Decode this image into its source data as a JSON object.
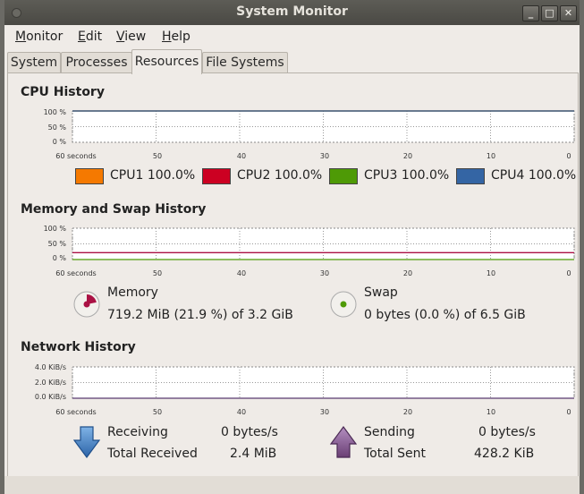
{
  "window": {
    "title": "System Monitor",
    "buttons": [
      "_",
      "□",
      "✕"
    ]
  },
  "menubar": {
    "items": [
      {
        "label": "Monitor",
        "mn": "M",
        "rest": "onitor"
      },
      {
        "label": "Edit",
        "mn": "E",
        "rest": "dit"
      },
      {
        "label": "View",
        "mn": "V",
        "rest": "iew"
      },
      {
        "label": "Help",
        "mn": "H",
        "rest": "elp"
      }
    ]
  },
  "tabs": {
    "items": [
      "System",
      "Processes",
      "Resources",
      "File Systems"
    ],
    "active": "Resources"
  },
  "cpu": {
    "title": "CPU History",
    "ytick_labels": [
      "100 %",
      "50 %",
      "0 %"
    ],
    "xtick_labels": [
      "60 seconds",
      "50",
      "40",
      "30",
      "20",
      "10",
      "0"
    ],
    "legend": [
      {
        "name": "CPU1",
        "value": "100.0%",
        "color": "#f57900"
      },
      {
        "name": "CPU2",
        "value": "100.0%",
        "color": "#cc0022"
      },
      {
        "name": "CPU3",
        "value": "100.0%",
        "color": "#4e9a06"
      },
      {
        "name": "CPU4",
        "value": "100.0%",
        "color": "#3465a4"
      }
    ]
  },
  "memswap": {
    "title": "Memory and Swap History",
    "ytick_labels": [
      "100 %",
      "50 %",
      "0 %"
    ],
    "xtick_labels": [
      "60 seconds",
      "50",
      "40",
      "30",
      "20",
      "10",
      "0"
    ],
    "memory": {
      "label": "Memory",
      "text": "719.2 MiB (21.9 %) of 3.2 GiB",
      "fraction": 0.219,
      "color": "#aa1144"
    },
    "swap": {
      "label": "Swap",
      "text": "0 bytes (0.0 %) of 6.5 GiB",
      "fraction": 0.0,
      "color": "#4e9a06"
    }
  },
  "network": {
    "title": "Network History",
    "ytick_labels": [
      "4.0 KiB/s",
      "2.0 KiB/s",
      "0.0 KiB/s"
    ],
    "xtick_labels": [
      "60 seconds",
      "50",
      "40",
      "30",
      "20",
      "10",
      "0"
    ],
    "receiving": {
      "label": "Receiving",
      "rate": "0 bytes/s",
      "total_label": "Total Received",
      "total": "2.4 MiB",
      "color": "#3465a4"
    },
    "sending": {
      "label": "Sending",
      "rate": "0 bytes/s",
      "total_label": "Total Sent",
      "total": "428.2 KiB",
      "color": "#75507b"
    }
  },
  "chart_data": [
    {
      "type": "line",
      "title": "CPU History",
      "x": [
        60,
        50,
        40,
        30,
        20,
        10,
        0
      ],
      "xlabel": "seconds",
      "ylim": [
        0,
        100
      ],
      "series": [
        {
          "name": "CPU1",
          "values": [
            100,
            100,
            100,
            100,
            100,
            100,
            100
          ]
        },
        {
          "name": "CPU2",
          "values": [
            100,
            100,
            100,
            100,
            100,
            100,
            100
          ]
        },
        {
          "name": "CPU3",
          "values": [
            100,
            100,
            100,
            100,
            100,
            100,
            100
          ]
        },
        {
          "name": "CPU4",
          "values": [
            100,
            100,
            100,
            100,
            100,
            100,
            100
          ]
        }
      ]
    },
    {
      "type": "line",
      "title": "Memory and Swap History",
      "x": [
        60,
        50,
        40,
        30,
        20,
        10,
        0
      ],
      "xlabel": "seconds",
      "ylim": [
        0,
        100
      ],
      "series": [
        {
          "name": "Memory",
          "values": [
            21.9,
            21.9,
            21.9,
            21.9,
            21.9,
            21.9,
            21.9
          ]
        },
        {
          "name": "Swap",
          "values": [
            0,
            0,
            0,
            0,
            0,
            0,
            0
          ]
        }
      ]
    },
    {
      "type": "line",
      "title": "Network History",
      "x": [
        60,
        50,
        40,
        30,
        20,
        10,
        0
      ],
      "xlabel": "seconds",
      "ylim": [
        0,
        4.0
      ],
      "series": [
        {
          "name": "Receiving",
          "values": [
            0,
            0,
            0,
            0,
            0,
            0,
            0
          ]
        },
        {
          "name": "Sending",
          "values": [
            0,
            0,
            0,
            0,
            0,
            0,
            0
          ]
        }
      ]
    }
  ]
}
